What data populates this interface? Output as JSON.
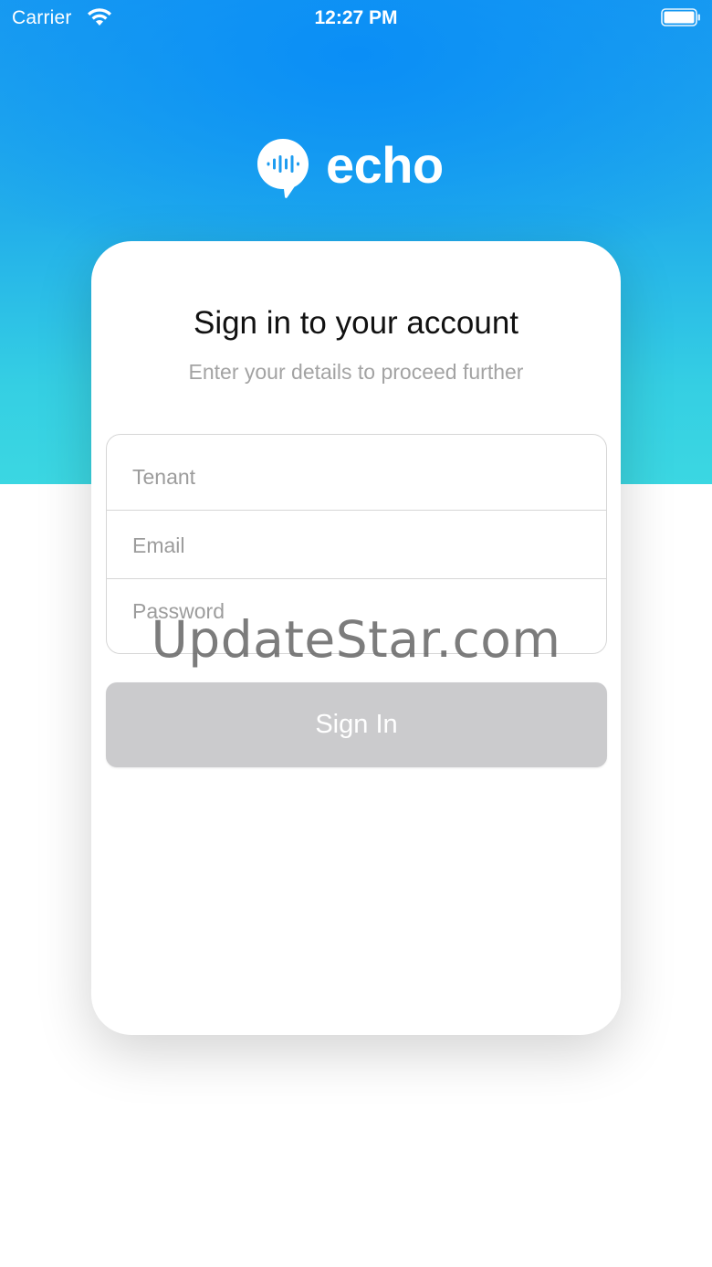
{
  "status_bar": {
    "carrier": "Carrier",
    "time": "12:27 PM",
    "icons": [
      "wifi-icon",
      "battery-icon"
    ]
  },
  "brand": {
    "name": "echo",
    "logo_icon": "speech-bubble-waveform-icon"
  },
  "card": {
    "title": "Sign in to your account",
    "subtitle": "Enter your details to proceed further"
  },
  "form": {
    "tenant": {
      "value": "",
      "placeholder": "Tenant"
    },
    "email": {
      "value": "",
      "placeholder": "Email"
    },
    "password": {
      "value": "",
      "placeholder": "Password"
    }
  },
  "actions": {
    "sign_in_label": "Sign In"
  },
  "watermark": "UpdateStar.com",
  "colors": {
    "header_gradient_top": "#1a9cf0",
    "header_gradient_bottom": "#3bd7e2",
    "button_disabled": "#cbcbcd",
    "logo_accent": "#1e9cf0"
  }
}
